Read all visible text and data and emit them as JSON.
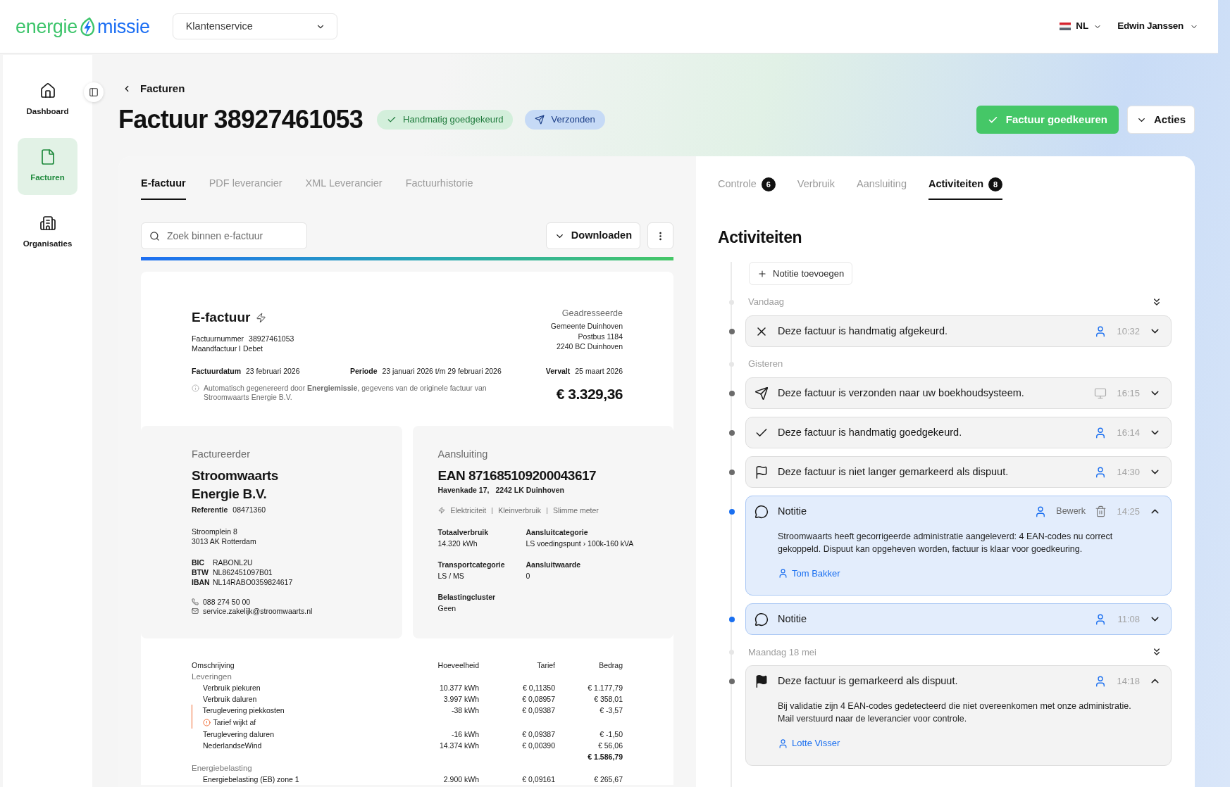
{
  "header": {
    "logo": {
      "part_1": "energie",
      "part_2": "missie"
    },
    "workspace": {
      "value": "Klantenservice"
    },
    "language": {
      "code": "NL"
    },
    "user": {
      "name": "Edwin Janssen"
    }
  },
  "sidebar": {
    "items": [
      {
        "label": "Dashboard",
        "kind": "home",
        "selected": false
      },
      {
        "label": "Facturen",
        "kind": "document",
        "selected": true
      },
      {
        "label": "Organisaties",
        "kind": "building",
        "selected": false
      }
    ]
  },
  "breadcrumb": {
    "label": "Facturen"
  },
  "title": "Factuur 38927461053",
  "status_badges": [
    {
      "label": "Handmatig goedgekeurd",
      "kind": "approved"
    },
    {
      "label": "Verzonden",
      "kind": "sent"
    }
  ],
  "actions": [
    {
      "label": "Factuur goedkeuren",
      "kind": "primary"
    },
    {
      "label": "Acties",
      "kind": "menu"
    }
  ],
  "document_tabs": [
    {
      "label": "E-factuur",
      "selected": true
    },
    {
      "label": "PDF leverancier",
      "selected": false
    },
    {
      "label": "XML Leverancier",
      "selected": false
    },
    {
      "label": "Factuurhistorie",
      "selected": false
    }
  ],
  "document_toolbar": {
    "search": {
      "placeholder": "Zoek binnen e-factuur"
    },
    "download": {
      "label": "Downloaden"
    }
  },
  "invoice": {
    "title": "E-factuur",
    "number": {
      "label": "Factuurnummer",
      "value": "38927461053"
    },
    "invoice_type": "Maandfactuur I Debet",
    "addressee": {
      "label": "Geadresseerde",
      "lines": [
        "Gemeente Duinhoven",
        "Postbus 1184",
        "2240 BC Duinhoven"
      ]
    },
    "dates": [
      {
        "label": "Factuurdatum",
        "value": "23 februari 2026"
      },
      {
        "label": "Periode",
        "value": "23 januari 2026 t/m 29 februari 2026"
      },
      {
        "label": "Vervalt",
        "value": "25 maart 2026"
      }
    ],
    "generated_note": "Automatisch gegenereerd door **Energiemissie**, gegevens van de originele factuur van Stroomwaarts Energie B.V.",
    "total": "€ 3.329,36",
    "supplier": {
      "label": "Factureerder",
      "name": "Stroomwaarts Energie B.V.",
      "reference": {
        "label": "Referentie",
        "value": "08471360"
      },
      "address": [
        "Stroomplein 8",
        "3013 AK Rotterdam"
      ],
      "bank": [
        {
          "label": "BIC",
          "value": "RABONL2U"
        },
        {
          "label": "BTW",
          "value": "NL862451097B01"
        },
        {
          "label": "IBAN",
          "value": "NL14RABO0359824617"
        }
      ],
      "contacts": [
        {
          "kind": "phone",
          "value": "088 274 50 00"
        },
        {
          "kind": "email",
          "value": "service.zakelijk@stroomwaarts.nl"
        }
      ]
    },
    "connection": {
      "label": "Aansluiting",
      "ean": "EAN 871685109200043617",
      "address": [
        "Havenkade 17,",
        "2242 LK Duinhoven"
      ],
      "tags": [
        "Elektriciteit",
        "Kleinverbruik",
        "Slimme meter"
      ],
      "fields": [
        {
          "label": "Totaalverbruik",
          "value": "14.320 kWh"
        },
        {
          "label": "Aansluitcategorie",
          "value": "LS voedingspunt › 100k-160 kVA"
        },
        {
          "label": "Transportcategorie",
          "value": "LS / MS"
        },
        {
          "label": "Aansluitwaarde",
          "value": "0"
        },
        {
          "label": "Belastingcluster",
          "value": "Geen"
        }
      ]
    },
    "lines_table": {
      "columns": [
        "Omschrijving",
        "Hoeveelheid",
        "Tarief",
        "Bedrag"
      ],
      "sections": [
        {
          "label": "Leveringen",
          "rows": [
            {
              "description": "Verbruik piekuren",
              "quantity": "10.377 kWh",
              "rate": "€ 0,11350",
              "amount": "€ 1.177,79"
            },
            {
              "description": "Verbruik daluren",
              "quantity": "3.997 kWh",
              "rate": "€ 0,08957",
              "amount": "€ 358,01"
            },
            {
              "description": "Teruglevering piekkosten",
              "quantity": "-38 kWh",
              "rate": "€ 0,09387",
              "amount": "€ -3,57",
              "warning": "Tarief wijkt af"
            },
            {
              "description": "Teruglevering daluren",
              "quantity": "-16 kWh",
              "rate": "€ 0,09387",
              "amount": "€ -1,50"
            },
            {
              "description": "NederlandseWind",
              "quantity": "14.374 kWh",
              "rate": "€ 0,00390",
              "amount": "€ 56,06"
            }
          ],
          "subtotal": "€ 1.586,79"
        },
        {
          "label": "Energiebelasting",
          "rows": [
            {
              "description": "Energiebelasting (EB) zone 1",
              "quantity": "2.900 kWh",
              "rate": "€ 0,09161",
              "amount": "€ 265,67"
            }
          ]
        }
      ]
    }
  },
  "panel_tabs": [
    {
      "label": "Controle",
      "count": "6",
      "selected": false
    },
    {
      "label": "Verbruik",
      "selected": false
    },
    {
      "label": "Aansluiting",
      "selected": false
    },
    {
      "label": "Activiteiten",
      "count": "8",
      "selected": true
    }
  ],
  "activities": {
    "title": "Activiteiten",
    "add_note": {
      "label": "Notitie toevoegen"
    },
    "groups": [
      {
        "label": "Vandaag",
        "collapse_all": true,
        "items": [
          {
            "kind": "rejected",
            "text": "Deze factuur is handmatig afgekeurd.",
            "actor": {
              "kind": "user"
            },
            "time": "10:32",
            "expanded": false,
            "deletable": false
          }
        ]
      },
      {
        "label": "Gisteren",
        "collapse_all": false,
        "items": [
          {
            "kind": "sent",
            "text": "Deze factuur is verzonden naar uw boekhoudsysteem.",
            "actor": {
              "kind": "system"
            },
            "time": "16:15",
            "expanded": false,
            "deletable": false
          },
          {
            "kind": "approved",
            "text": "Deze factuur is handmatig goedgekeurd.",
            "actor": {
              "kind": "user"
            },
            "time": "16:14",
            "expanded": false,
            "deletable": false
          },
          {
            "kind": "undisputed",
            "text": "Deze factuur is niet langer gemarkeerd als dispuut.",
            "actor": {
              "kind": "user"
            },
            "time": "14:30",
            "expanded": false,
            "deletable": false
          },
          {
            "kind": "note",
            "text": "Notitie",
            "actor": {
              "kind": "user"
            },
            "edit_label": "Bewerk",
            "deletable": true,
            "time": "14:25",
            "expanded": true,
            "body": "Stroomwaarts heeft gecorrigeerde administratie aangeleverd: 4 EAN-codes nu correct gekoppeld. Dispuut kan opgeheven worden, factuur is klaar voor goedkeuring.",
            "author": "Tom Bakker"
          },
          {
            "kind": "note",
            "text": "Notitie",
            "actor": {
              "kind": "user"
            },
            "time": "11:08",
            "expanded": false,
            "deletable": false
          }
        ]
      },
      {
        "label": "Maandag 18 mei",
        "collapse_all": true,
        "items": [
          {
            "kind": "disputed",
            "text": "Deze factuur is gemarkeerd als dispuut.",
            "actor": {
              "kind": "user"
            },
            "time": "14:18",
            "expanded": true,
            "deletable": false,
            "body": "Bij validatie zijn 4 EAN-codes gedetecteerd die niet overeenkomen met onze administratie. Mail verstuurd naar de leverancier voor controle.",
            "author": "Lotte Visser"
          }
        ]
      }
    ]
  }
}
